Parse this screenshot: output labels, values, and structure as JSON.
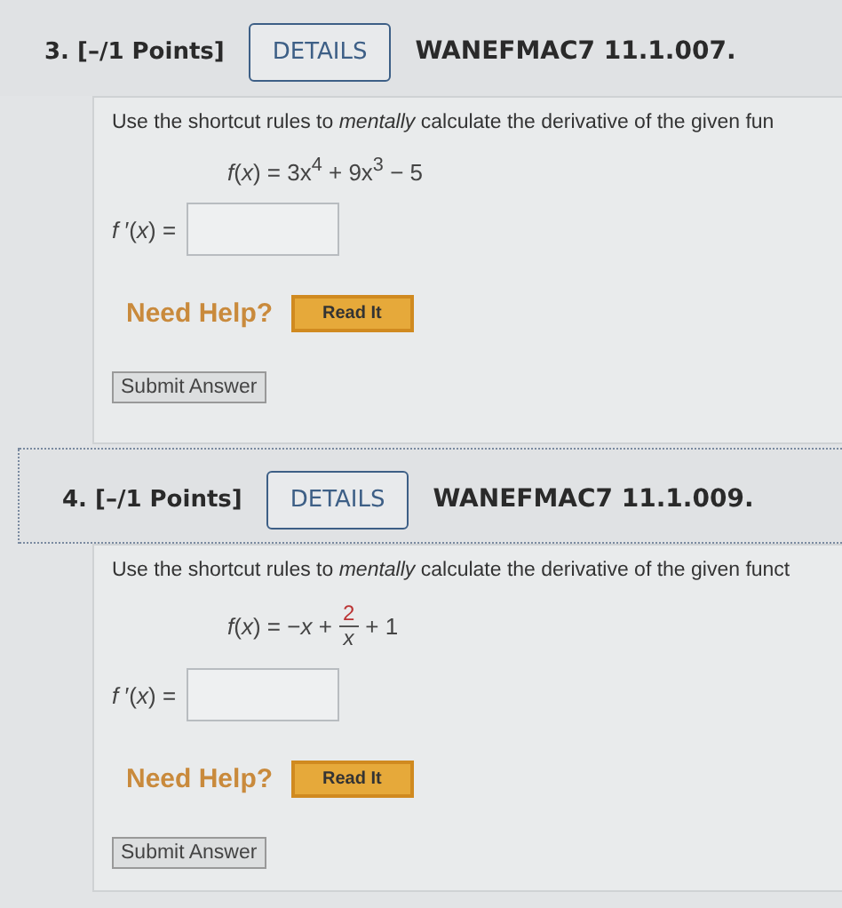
{
  "questions": [
    {
      "number": "3.",
      "points": "[–/1 Points]",
      "details": "DETAILS",
      "code": "WANEFMAC7 11.1.007.",
      "focused": false,
      "prompt": "Use the shortcut rules to *mentally* calculate the derivative of the given fun",
      "equation": {
        "kind": "plain",
        "text": "*f*(*x*) = 3x$^{4}$ + 9x$^{3}$ − 5"
      },
      "answer_label": "*f* ′(*x*) =",
      "help": "Need Help?",
      "read_it": "Read It",
      "submit": "Submit Answer"
    },
    {
      "number": "4.",
      "points": "[–/1 Points]",
      "details": "DETAILS",
      "code": "WANEFMAC7 11.1.009.",
      "focused": true,
      "prompt": "Use the shortcut rules to *mentally* calculate the derivative of the given funct",
      "equation": {
        "kind": "fraction",
        "lead": "*f*(*x*) = −*x* +",
        "numerator": "2",
        "denominator": "*x*",
        "tail": "+ 1"
      },
      "answer_label": "*f* ′(*x*) =",
      "help": "Need Help?",
      "read_it": "Read It",
      "submit": "Submit Answer"
    }
  ]
}
